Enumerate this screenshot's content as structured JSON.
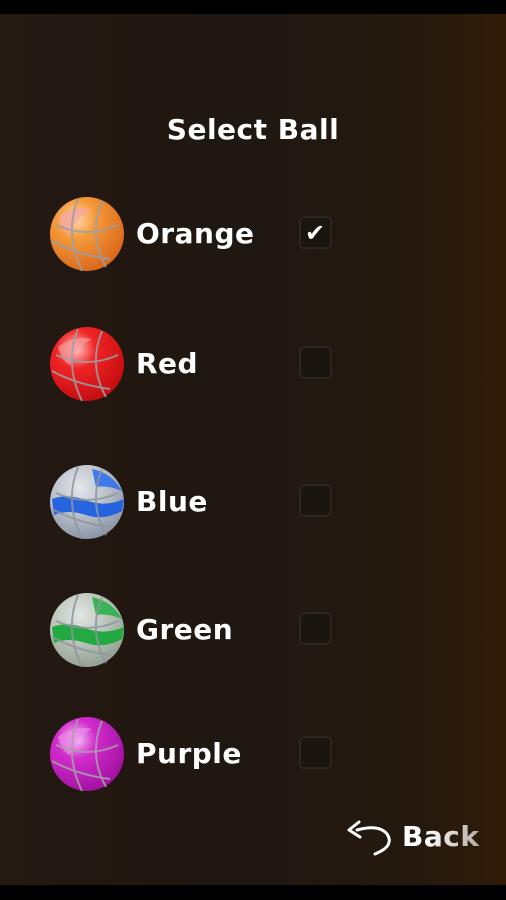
{
  "screen": {
    "title": "Select Ball"
  },
  "balls": [
    {
      "id": "orange",
      "label": "Orange",
      "checked": true,
      "color": "#f28a1e",
      "highlight": "#f6a6a0"
    },
    {
      "id": "red",
      "label": "Red",
      "checked": false,
      "color": "#e5141a",
      "highlight": "#f59a9a"
    },
    {
      "id": "blue",
      "label": "Blue",
      "checked": false,
      "color": "#1f5fe0",
      "highlight": "#cfd4dd"
    },
    {
      "id": "green",
      "label": "Green",
      "checked": false,
      "color": "#1aa83a",
      "highlight": "#cfd8cf"
    },
    {
      "id": "purple",
      "label": "Purple",
      "checked": false,
      "color": "#c01aba",
      "highlight": "#e88ae6"
    }
  ],
  "footer": {
    "back_label": "Back",
    "back_icon": "undo-arrow-icon"
  }
}
